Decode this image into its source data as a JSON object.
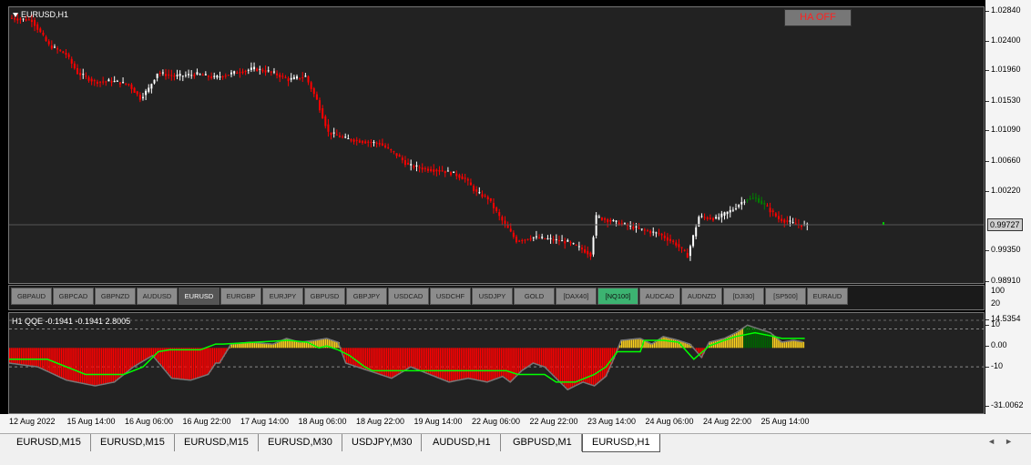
{
  "chart": {
    "title": "EURUSD,H1",
    "ha_button": "HA OFF",
    "current_price": "0.99727",
    "price_labels": [
      "1.02840",
      "1.02400",
      "1.01960",
      "1.01530",
      "1.01090",
      "1.00660",
      "1.00220",
      "0.99727",
      "0.99350",
      "0.98910"
    ],
    "button_pane_labels": [
      "100",
      "20"
    ],
    "indicator_labels": [
      "14.5354",
      "10",
      "0.00",
      "-10",
      "-31.0062"
    ],
    "time_labels": [
      "12 Aug 2022",
      "15 Aug 14:00",
      "16 Aug 06:00",
      "16 Aug 22:00",
      "17 Aug 14:00",
      "18 Aug 06:00",
      "18 Aug 22:00",
      "19 Aug 14:00",
      "22 Aug 06:00",
      "22 Aug 22:00",
      "23 Aug 14:00",
      "24 Aug 06:00",
      "24 Aug 22:00",
      "25 Aug 14:00"
    ]
  },
  "symbols": [
    "GBPAUD",
    "GBPCAD",
    "GBPNZD",
    "AUDUSD",
    "EURUSD",
    "EURGBP",
    "EURJPY",
    "GBPUSD",
    "GBPJPY",
    "USDCAD",
    "USDCHF",
    "USDJPY",
    "GOLD",
    "[DAX40]",
    "[NQ100]",
    "AUDCAD",
    "AUDNZD",
    "[DJI30]",
    "[SP500]",
    "EURAUD"
  ],
  "active_symbol": "EURUSD",
  "highlight_symbol": "[NQ100]",
  "indicator": {
    "title": "H1 QQE -0.1941 -0.1941 2.8005"
  },
  "tabs": [
    "EURUSD,M15",
    "EURUSD,M15",
    "EURUSD,M15",
    "EURUSD,M30",
    "USDJPY,M30",
    "AUDUSD,H1",
    "GBPUSD,M1",
    "EURUSD,H1"
  ],
  "active_tab": "EURUSD,H1",
  "colors": {
    "bear": "#ff0000",
    "bull": "#ffffff",
    "green_candle": "#008000",
    "qqe_line": "#00ff00",
    "qqe_up": "#ffd21e",
    "qqe_down": "#ff0000",
    "qqe_strong": "#006400"
  }
}
